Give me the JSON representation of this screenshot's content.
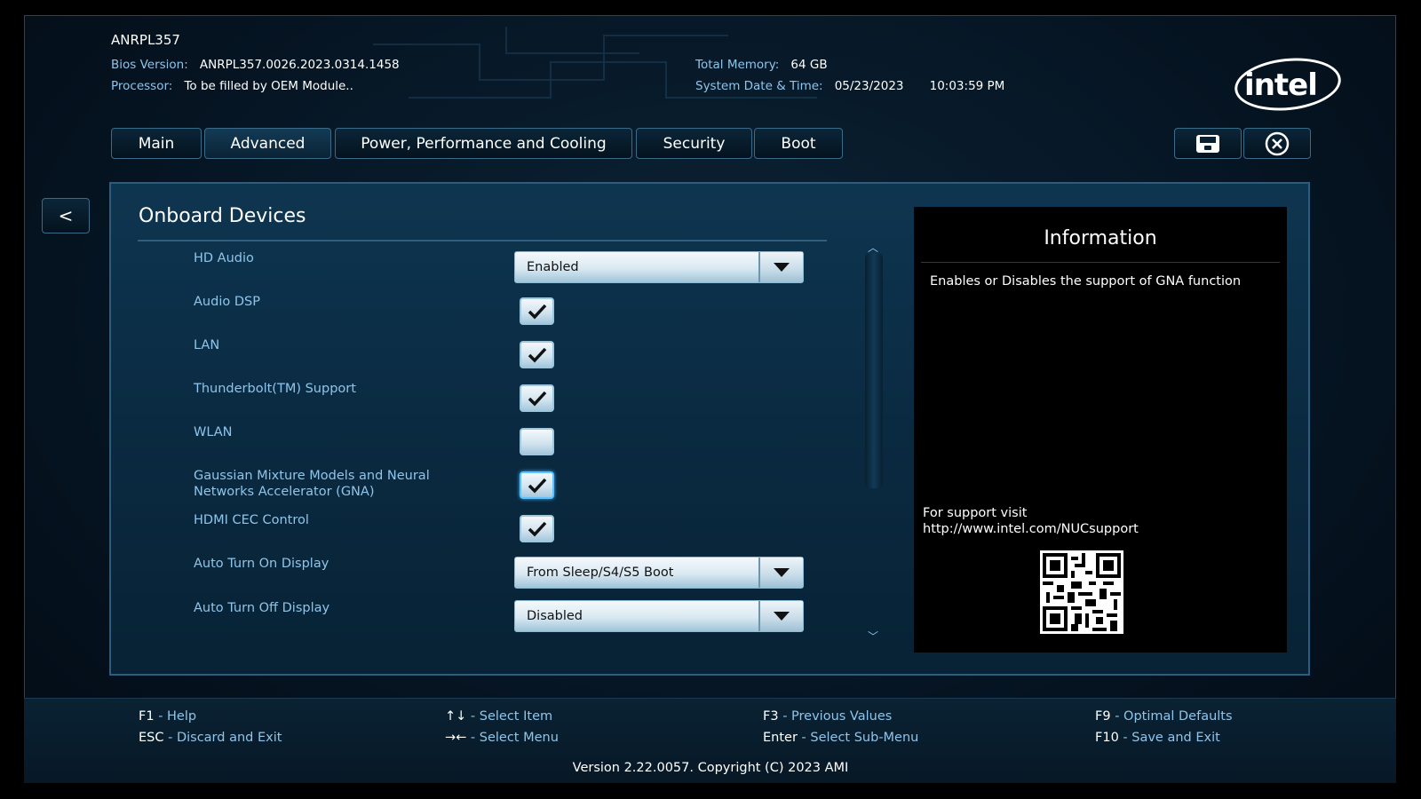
{
  "header": {
    "board": "ANRPL357",
    "bios_label": "Bios Version:",
    "bios_value": "ANRPL357.0026.2023.0314.1458",
    "processor_label": "Processor:",
    "processor_value": "To be filled by OEM Module..",
    "memory_label": "Total Memory:",
    "memory_value": "64 GB",
    "datetime_label": "System Date & Time:",
    "date_value": "05/23/2023",
    "time_value": "10:03:59 PM",
    "logo_text": "intel"
  },
  "tabs": [
    {
      "label": "Main"
    },
    {
      "label": "Advanced"
    },
    {
      "label": "Power, Performance and Cooling"
    },
    {
      "label": "Security"
    },
    {
      "label": "Boot"
    }
  ],
  "back_label": "<",
  "section": {
    "title": "Onboard Devices",
    "rows": [
      {
        "label": "HD Audio",
        "type": "dropdown",
        "value": "Enabled"
      },
      {
        "label": "Audio DSP",
        "type": "checkbox",
        "checked": true
      },
      {
        "label": "LAN",
        "type": "checkbox",
        "checked": true
      },
      {
        "label": "Thunderbolt(TM) Support",
        "type": "checkbox",
        "checked": true
      },
      {
        "label": "WLAN",
        "type": "checkbox",
        "checked": false
      },
      {
        "label": "Gaussian Mixture Models and Neural Networks Accelerator (GNA)",
        "type": "checkbox",
        "checked": true
      },
      {
        "label": "HDMI CEC Control",
        "type": "checkbox",
        "checked": true
      },
      {
        "label": "Auto Turn On Display",
        "type": "dropdown",
        "value": "From Sleep/S4/S5 Boot"
      },
      {
        "label": "Auto Turn Off Display",
        "type": "dropdown",
        "value": "Disabled"
      }
    ]
  },
  "info": {
    "title": "Information",
    "text": "Enables or Disables the support of GNA function",
    "support_line1": "For support visit",
    "support_line2": "http://www.intel.com/NUCsupport"
  },
  "footer": {
    "f1_key": "F1",
    "f1_desc": "Help",
    "esc_key": "ESC",
    "esc_desc": "Discard and Exit",
    "arrows_ud": "↑↓",
    "arrows_ud_desc": "Select Item",
    "arrows_lr": "→←",
    "arrows_lr_desc": "Select Menu",
    "f3_key": "F3",
    "f3_desc": "Previous Values",
    "enter_key": "Enter",
    "enter_desc": "Select Sub-Menu",
    "f9_key": "F9",
    "f9_desc": "Optimal Defaults",
    "f10_key": "F10",
    "f10_desc": "Save and Exit",
    "version": "Version 2.22.0057. Copyright (C) 2023 AMI"
  }
}
